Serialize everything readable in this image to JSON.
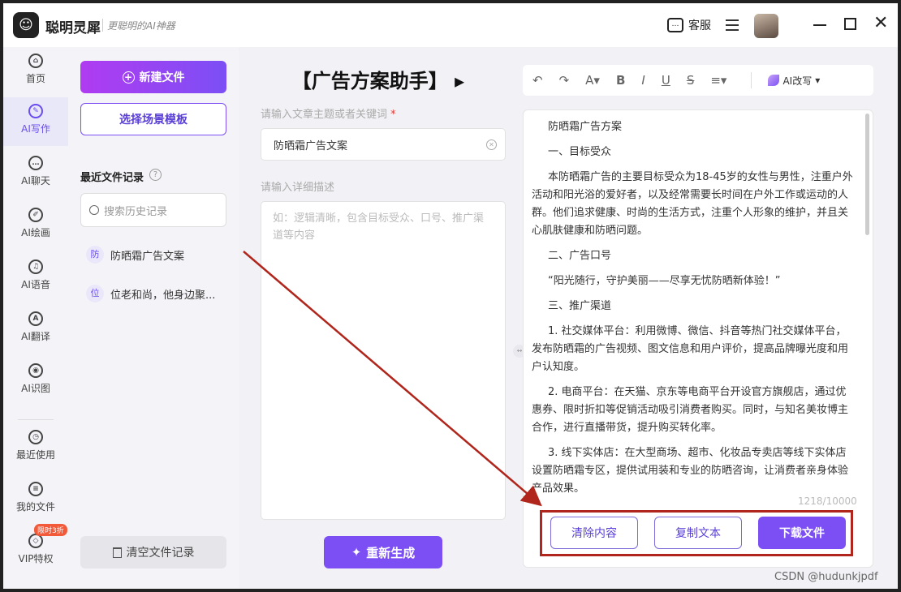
{
  "app": {
    "name": "聪明灵犀",
    "slogan": "更聪明的AI神器",
    "logo_glyph": "☺"
  },
  "titlebar": {
    "service_label": "客服",
    "service_icon": "chat-icon"
  },
  "nav": {
    "items": [
      {
        "label": "首页",
        "icon": "home-icon",
        "glyph": "⌂"
      },
      {
        "label": "AI写作",
        "icon": "pen-icon",
        "glyph": "✎",
        "active": true
      },
      {
        "label": "AI聊天",
        "icon": "chat-bubble-icon",
        "glyph": "…"
      },
      {
        "label": "AI绘画",
        "icon": "brush-icon",
        "glyph": "✐"
      },
      {
        "label": "AI语音",
        "icon": "headphones-icon",
        "glyph": "♫"
      },
      {
        "label": "AI翻译",
        "icon": "translate-icon",
        "glyph": "A"
      },
      {
        "label": "AI识图",
        "icon": "scan-icon",
        "glyph": "◉"
      },
      {
        "label": "最近使用",
        "icon": "clock-icon",
        "glyph": "◷"
      },
      {
        "label": "我的文件",
        "icon": "file-icon",
        "glyph": "≡"
      },
      {
        "label": "VIP特权",
        "icon": "diamond-icon",
        "glyph": "◇"
      }
    ],
    "vip_badge": "限时3折"
  },
  "files": {
    "new_button": "新建文件",
    "template_button": "选择场景模板",
    "recent_title": "最近文件记录",
    "search_placeholder": "搜索历史记录",
    "history": [
      {
        "tag": "防",
        "title": "防晒霜广告文案"
      },
      {
        "tag": "位",
        "title": "位老和尚，他身边聚..."
      }
    ],
    "clear_button": "清空文件记录"
  },
  "form": {
    "title": "【广告方案助手】",
    "topic_label": "请输入文章主题或者关键词",
    "required_mark": "*",
    "topic_value": "防晒霜广告文案",
    "desc_label": "请输入详细描述",
    "desc_placeholder": "如：逻辑清晰，包含目标受众、口号、推广渠道等内容",
    "regenerate_button": "重新生成"
  },
  "editor": {
    "ai_rewrite": "AI改写",
    "content": [
      "防晒霜广告方案",
      "一、目标受众",
      "本防晒霜广告的主要目标受众为18-45岁的女性与男性，注重户外活动和阳光浴的爱好者，以及经常需要长时间在户外工作或运动的人群。他们追求健康、时尚的生活方式，注重个人形象的维护，并且关心肌肤健康和防晒问题。",
      "二、广告口号",
      "“阳光随行，守护美丽——尽享无忧防晒新体验！”",
      "三、推广渠道",
      "1. 社交媒体平台：利用微博、微信、抖音等热门社交媒体平台，发布防晒霜的广告视频、图文信息和用户评价，提高品牌曝光度和用户认知度。",
      "2. 电商平台：在天猫、京东等电商平台开设官方旗舰店，通过优惠券、限时折扣等促销活动吸引消费者购买。同时，与知名美妆博主合作，进行直播带货，提升购买转化率。",
      "3. 线下实体店：在大型商场、超市、化妆品专卖店等线下实体店设置防晒霜专区，提供试用装和专业的防晒咨询，让消费者亲身体验产品效果。"
    ],
    "char_count": "1218/10000",
    "clear_button": "清除内容",
    "copy_button": "复制文本",
    "download_button": "下载文件"
  },
  "watermark": "CSDN @hudunkjpdf",
  "colors": {
    "accent": "#7c4ff5",
    "annotation": "#b0261c"
  }
}
